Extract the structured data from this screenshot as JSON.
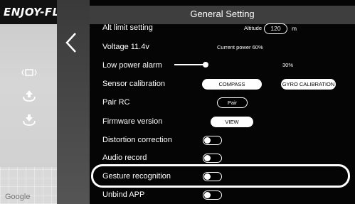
{
  "brand": "ENJOY-FL",
  "map_attribution": "Google",
  "header": {
    "title": "General Setting"
  },
  "rows": {
    "alt_limit": {
      "label": "Alt limit setting",
      "altitude_label": "Altitude",
      "altitude_value": "120",
      "unit": "m"
    },
    "voltage": {
      "label": "Voltage 11.4v",
      "current_power": "Current power 60%"
    },
    "low_power": {
      "label": "Low power alarm",
      "value": "30%",
      "level": 0.3
    },
    "sensor_calibration": {
      "label": "Sensor calibration",
      "compass_button": "COMPASS CALIBRATION",
      "gyro_button": "GYRO CALIBRATION"
    },
    "pair_rc": {
      "label": "Pair RC",
      "button": "Pair"
    },
    "firmware": {
      "label": "Firmware version",
      "button": "VIEW"
    },
    "distortion": {
      "label": "Distortion correction",
      "on": false
    },
    "audio": {
      "label": "Audio record",
      "on": false
    },
    "gesture": {
      "label": "Gesture recognition",
      "on": false
    },
    "unbind": {
      "label": "Unbind APP",
      "on": false
    }
  },
  "icons": [
    "screen-icon",
    "takeoff-icon",
    "landing-icon",
    "back-chevron-icon"
  ]
}
